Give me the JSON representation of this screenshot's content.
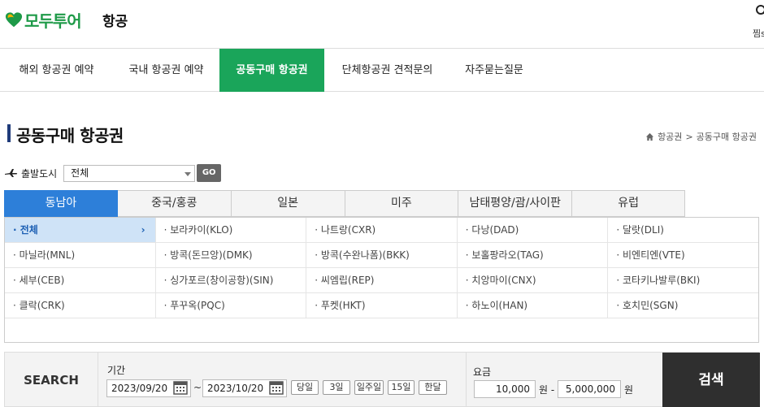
{
  "header": {
    "brand": "모두투어",
    "section_title": "항공",
    "favorites_label": "찜s",
    "brand_color": "#1e9a48"
  },
  "nav": {
    "items": [
      {
        "label": "해외 항공권 예약"
      },
      {
        "label": "국내 항공권 예약"
      },
      {
        "label": "공동구매 항공권",
        "active": true
      },
      {
        "label": "단체항공권 견적문의"
      },
      {
        "label": "자주묻는질문"
      }
    ],
    "active_color": "#1aa55a"
  },
  "page": {
    "title": "공동구매 항공권",
    "breadcrumb": [
      "항공권",
      "공동구매 항공권"
    ]
  },
  "departure": {
    "label": "출발도시",
    "selected": "전체",
    "go_label": "GO"
  },
  "regions": {
    "tabs": [
      "동남아",
      "중국/홍콩",
      "일본",
      "미주",
      "남태평양/괌/사이판",
      "유럽"
    ],
    "active_index": 0,
    "active_color": "#2d7fd9"
  },
  "cities": {
    "rows": [
      [
        "· 전체",
        "· 보라카이(KLO)",
        "· 나트랑(CXR)",
        "· 다낭(DAD)",
        "· 달랏(DLI)"
      ],
      [
        "· 마닐라(MNL)",
        "· 방콕(돈므앙)(DMK)",
        "· 방콕(수완나폼)(BKK)",
        "· 보홀팡라오(TAG)",
        "· 비엔티엔(VTE)"
      ],
      [
        "· 세부(CEB)",
        "· 싱가포르(창이공항)(SIN)",
        "· 씨엠립(REP)",
        "· 치앙마이(CNX)",
        "· 코타키나발루(BKI)"
      ],
      [
        "· 클락(CRK)",
        "· 푸꾸옥(PQC)",
        "· 푸켓(HKT)",
        "· 하노이(HAN)",
        "· 호치민(SGN)"
      ]
    ],
    "selected_chevron": "›"
  },
  "search": {
    "label": "SEARCH",
    "period_label": "기간",
    "date_from": "2023/09/20",
    "date_to": "2023/10/20",
    "tilde": "~",
    "quick_buttons": [
      "당일",
      "3일",
      "일주일",
      "15일",
      "한달"
    ],
    "fare_label": "요금",
    "fare_min": "10,000",
    "fare_max": "5,000,000",
    "won_dash": "원 -",
    "won": "원",
    "submit_label": "검색"
  }
}
